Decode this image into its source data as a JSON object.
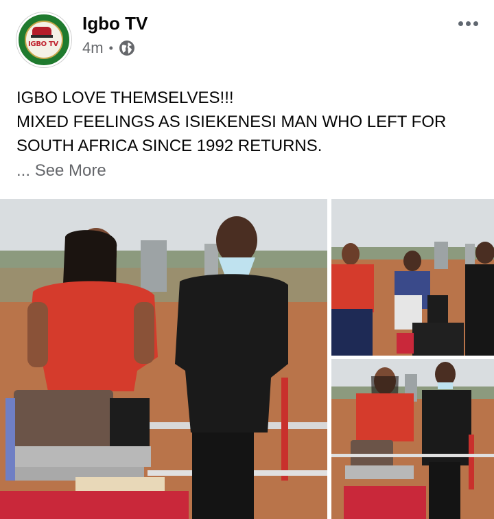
{
  "post": {
    "page_name": "Igbo TV",
    "timestamp": "4m",
    "separator": "•",
    "privacy_icon": "globe-icon",
    "more_icon": "more-options-icon",
    "avatar": {
      "logo_text": "IGBO TV",
      "colors": {
        "ring": "#1f7a2e",
        "text": "#c0232f",
        "gold": "#c8a64a"
      }
    },
    "text_lines": [
      "IGBO LOVE THEMSELVES!!!",
      "MIXED FEELINGS AS ISIEKENESI MAN WHO LEFT FOR",
      "SOUTH AFRICA SINCE 1992 RETURNS."
    ],
    "ellipsis": "...",
    "see_more_label": "See More",
    "photos": [
      {
        "name": "main-photo",
        "subject": "woman in red top and man in black suit beside luggage trolley"
      },
      {
        "name": "top-right-photo",
        "subject": "group standing with luggage on a dirt road"
      },
      {
        "name": "bottom-right-photo",
        "subject": "woman in red and man in black beside luggage trolley"
      }
    ],
    "colors": {
      "text": "#050505",
      "secondary_text": "#65676b",
      "icon": "#606770"
    }
  }
}
